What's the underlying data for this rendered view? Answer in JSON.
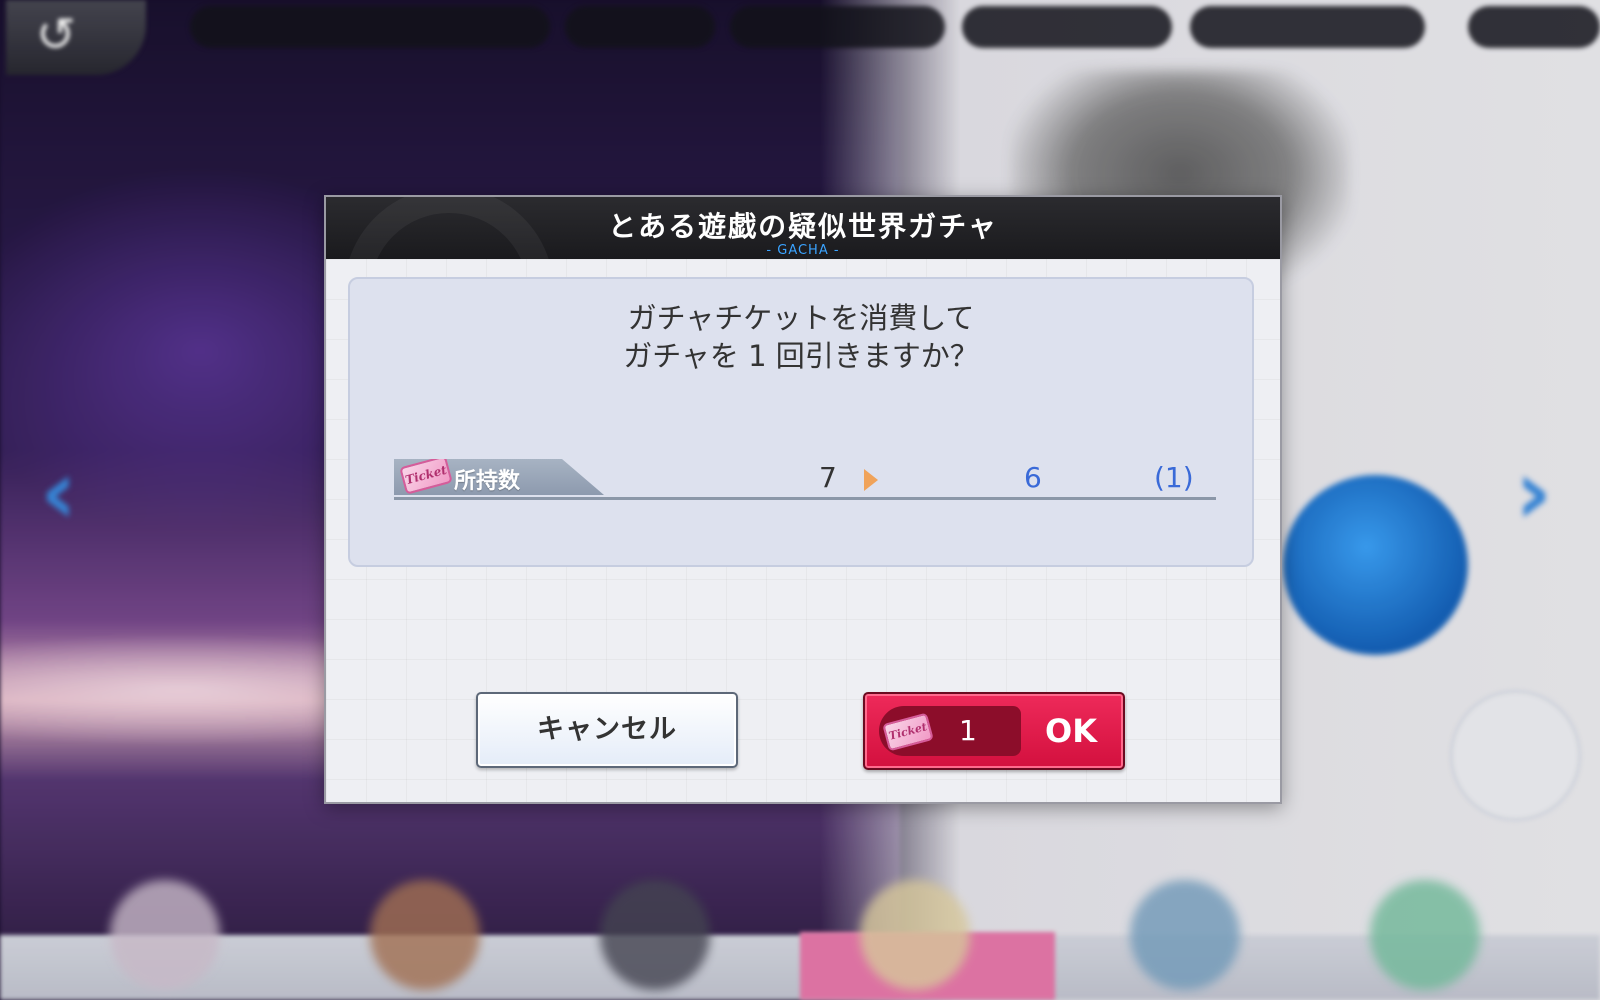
{
  "dialog": {
    "title": "とある遊戯の疑似世界ガチャ",
    "subtitle": "- GACHA -",
    "message_line1": "ガチャチケットを消費して",
    "message_line2": "ガチャを 1 回引きますか？",
    "count_label": "所持数",
    "ticket_text": "Ticket",
    "count_before": "7",
    "count_after": "6",
    "count_diff": "(1)",
    "cancel_label": "キャンセル",
    "ok_cost": "1",
    "ok_label": "OK"
  },
  "colors": {
    "header_bg": "#1f1f22",
    "subtitle": "#3aa3ff",
    "ok_button": "#e0154a",
    "count_highlight": "#3a6ad8",
    "arrow": "#f0a35a"
  },
  "icons": {
    "back": "back-arrow-icon",
    "ticket": "ticket-icon",
    "arrow_right": "triangle-right-icon",
    "nav_left": "chevron-left-icon",
    "nav_right": "chevron-right-icon"
  }
}
